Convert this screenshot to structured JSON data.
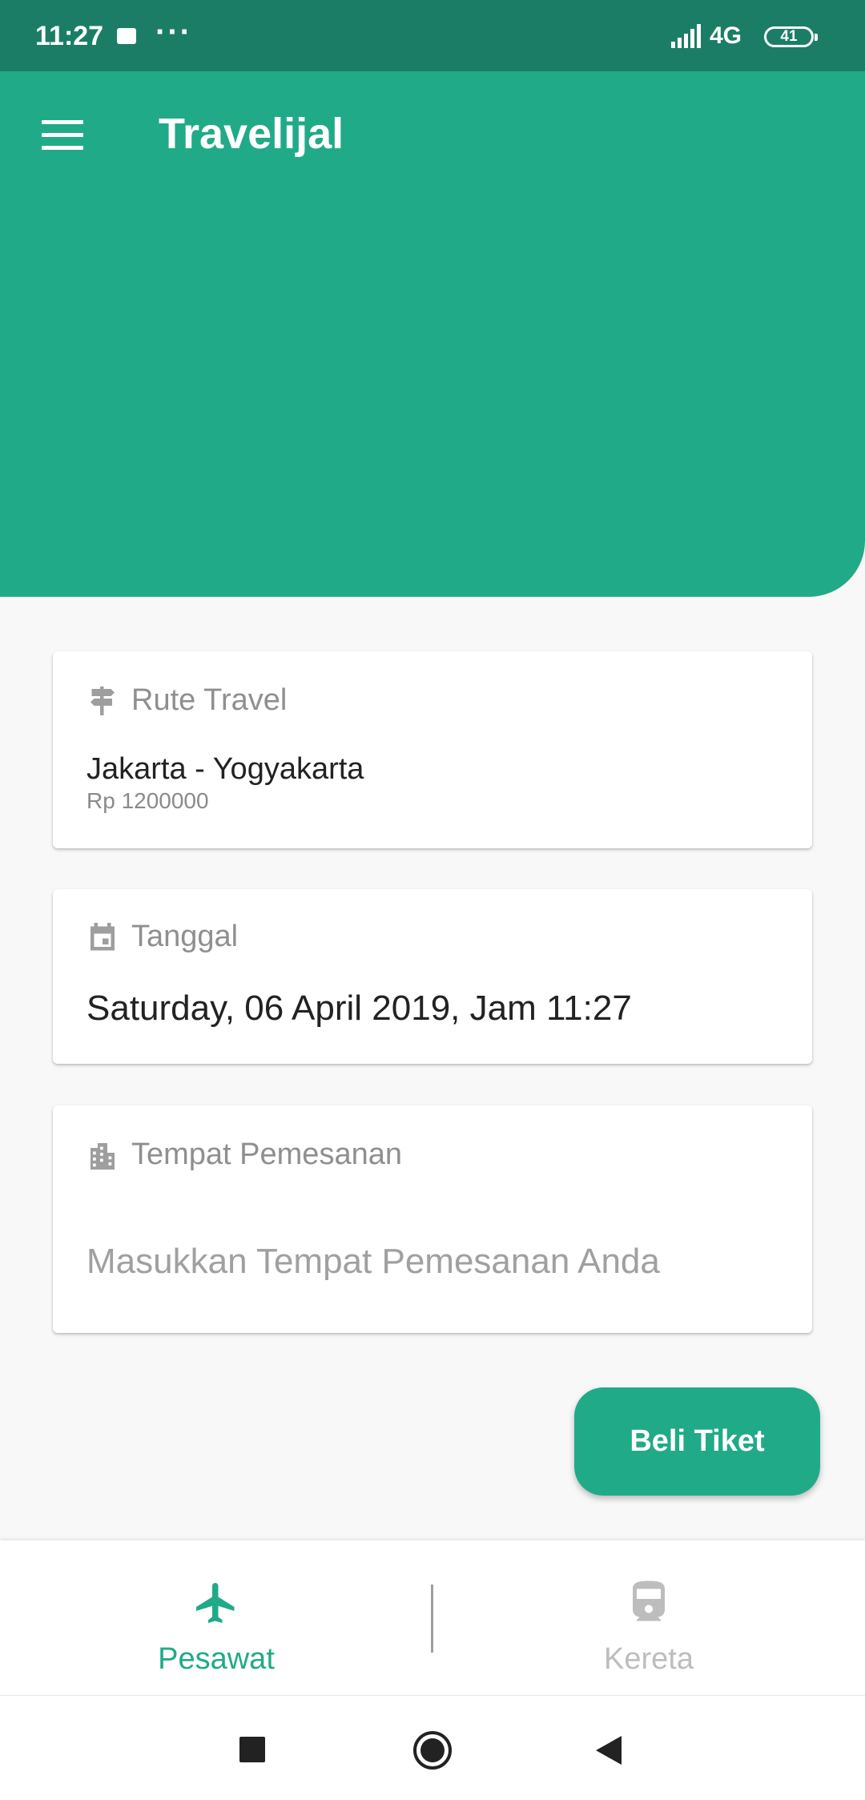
{
  "status_bar": {
    "time": "11:27",
    "dots": "···",
    "network": "4G",
    "battery": "41"
  },
  "app": {
    "title": "Travelijal"
  },
  "route_card": {
    "label": "Rute Travel",
    "route": "Jakarta - Yogyakarta",
    "price": "Rp 1200000"
  },
  "date_card": {
    "label": "Tanggal",
    "value": "Saturday, 06 April 2019, Jam 11:27"
  },
  "place_card": {
    "label": "Tempat Pemesanan",
    "value": "",
    "placeholder": "Masukkan Tempat Pemesanan Anda"
  },
  "buy_button": {
    "label": "Beli Tiket"
  },
  "bottom_nav": {
    "active_color": "#21aa88",
    "inactive_color": "#bdbdbd",
    "items": [
      {
        "label": "Pesawat",
        "icon": "airplane-icon",
        "active": true
      },
      {
        "label": "Kereta",
        "icon": "train-icon",
        "active": false
      }
    ]
  },
  "colors": {
    "primary": "#21aa88",
    "status_bar": "#1c7d66"
  }
}
